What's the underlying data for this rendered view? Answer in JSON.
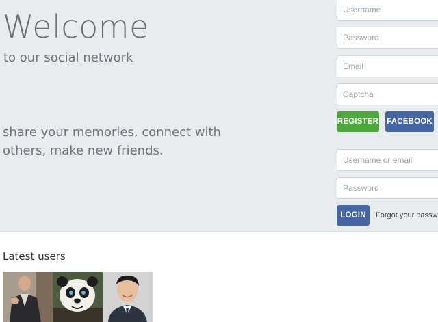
{
  "hero": {
    "title": "Welcome",
    "subtitle": "to our social network",
    "tagline": "share your memories, connect with others, make new friends."
  },
  "register": {
    "username_placeholder": "Username",
    "password_placeholder": "Password",
    "email_placeholder": "Email",
    "captcha_placeholder": "Captcha",
    "register_label": "REGISTER",
    "facebook_label": "FACEBOOK"
  },
  "login": {
    "username_placeholder": "Username or email",
    "password_placeholder": "Password",
    "login_label": "LOGIN",
    "forgot_label": "Forgot your password?"
  },
  "latest": {
    "title": "Latest users",
    "users": [
      {
        "alt": ""
      },
      {
        "alt": ""
      },
      {
        "alt": ""
      }
    ]
  },
  "colors": {
    "hero_bg": "#e8ecef",
    "register_green": "#4aa93a",
    "facebook_blue": "#4466a5"
  }
}
